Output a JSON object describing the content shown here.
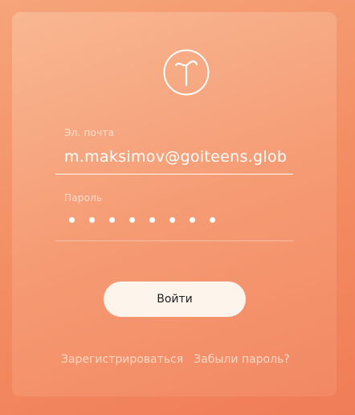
{
  "logo": {
    "icon": "tilda-logo-icon",
    "color": "#ffffff"
  },
  "form": {
    "email_label": "Эл. почта",
    "email_value": "m.maksimov@goiteens.glob",
    "password_label": "Пароль",
    "password_mask_count": 8,
    "submit_label": "Войти"
  },
  "links": {
    "register": "Зарегистрироваться",
    "forgot_password": "Забыли пароль?"
  },
  "colors": {
    "background": "#f38c62",
    "button_bg": "#fdf4ec",
    "text": "#ffffff"
  }
}
